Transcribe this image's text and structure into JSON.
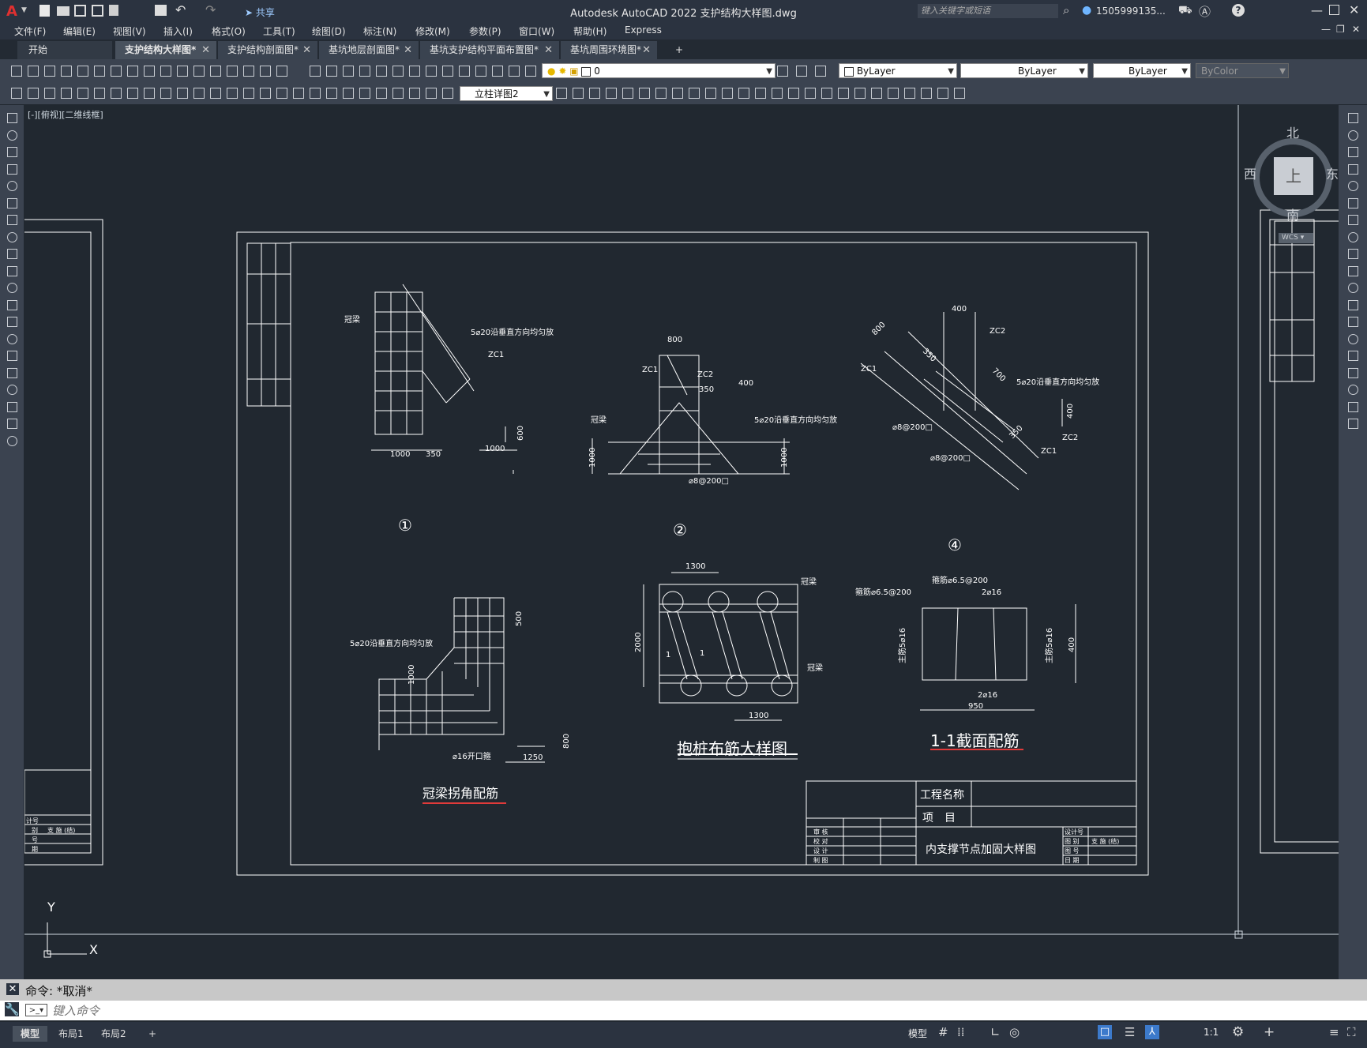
{
  "app": {
    "title": "Autodesk AutoCAD 2022    支护结构大样图.dwg",
    "share_label": "共享",
    "search_placeholder": "键入关键字或短语",
    "user_label": "1505999135..."
  },
  "menu": [
    "文件(F)",
    "编辑(E)",
    "视图(V)",
    "插入(I)",
    "格式(O)",
    "工具(T)",
    "绘图(D)",
    "标注(N)",
    "修改(M)",
    "参数(P)",
    "窗口(W)",
    "帮助(H)",
    "Express"
  ],
  "tabs": [
    {
      "label": "开始",
      "active": false
    },
    {
      "label": "支护结构大样图*",
      "active": true
    },
    {
      "label": "支护结构剖面图*",
      "active": false
    },
    {
      "label": "基坑地层剖面图*",
      "active": false
    },
    {
      "label": "基坑支护结构平面布置图*",
      "active": false
    },
    {
      "label": "基坑周围环境图*",
      "active": false
    }
  ],
  "toolbar": {
    "layer_value": "0",
    "color_value": "ByLayer",
    "linetype_value": "ByLayer",
    "lineweight_value": "ByLayer",
    "plotstyle_value": "ByColor",
    "dimstyle_value": "立柱详图2"
  },
  "viewport": {
    "label": "[-][俯视][二维线框]",
    "compass_n": "北",
    "compass_s": "南",
    "compass_e": "东",
    "compass_w": "西",
    "compass_center": "上",
    "wcs": "WCS",
    "ucs_x": "X",
    "ucs_y": "Y"
  },
  "drawing": {
    "d1_label": "①",
    "d2_label": "②",
    "d4_label": "④",
    "d1_guanliang": "冠梁",
    "d1_rebar": "5⌀20沿垂直方向均匀放",
    "d1_zc1": "ZC1",
    "d1_dim_a": "1000",
    "d1_dim_b": "350",
    "d1_dim_c": "1000",
    "d1_dim_d": "600",
    "d2_dim_top": "800",
    "d2_zc1": "ZC1",
    "d2_zc2": "ZC2",
    "d2_dim_350": "350",
    "d2_dim_400": "400",
    "d2_rebar": "5⌀20沿垂直方向均匀放",
    "d2_guanliang": "冠梁",
    "d2_stirrup": "⌀8@200□",
    "d2_dim_l": "1000",
    "d2_dim_r": "1000",
    "d4_dim_400": "400",
    "d4_dim_800": "800",
    "d4_zc2a": "ZC2",
    "d4_zc1": "ZC1",
    "d4_dim_350": "350",
    "d4_dim_700": "700",
    "d4_rebar": "5⌀20沿垂直方向均匀放",
    "d4_dim_400b": "400",
    "d4_stirrup_a": "⌀8@200□",
    "d4_zc2b": "ZC2",
    "d4_dim_350b": "350",
    "d4_zc1b": "ZC1",
    "d4_stirrup_b": "⌀8@200□",
    "c_rebar": "5⌀20沿垂直方向均匀放",
    "c_dim_500": "500",
    "c_dim_1000": "1000",
    "c_hoop": "⌀16开口箍",
    "c_dim_1250": "1250",
    "c_dim_800": "800",
    "c_title": "冠梁拐角配筋",
    "p_dim_1300a": "1300",
    "p_guanliang_a": "冠梁",
    "p_dim_2000": "2000",
    "p_cut": "1",
    "p_cut2": "1",
    "p_guanliang_b": "冠梁",
    "p_dim_1300b": "1300",
    "p_title": "抱桩布筋大样图",
    "s_stirrup_a": "箍筋⌀6.5@200",
    "s_stirrup_b": "箍筋⌀6.5@200",
    "s_top": "2⌀16",
    "s_left": "主筋5⌀16",
    "s_right": "主筋5⌀16",
    "s_bottom": "2⌀16",
    "s_dim_950": "950",
    "s_dim_400": "400",
    "s_title": "1-1截面配筋",
    "tb_project_name": "工程名称",
    "tb_item": "项　目",
    "tb_drawing_name": "内支撑节点加固大样图",
    "tb_shen": "审 核",
    "tb_jiao": "校 对",
    "tb_she": "设 计",
    "tb_zhi": "制 图",
    "tb_no": "设计号",
    "tb_cat": "图 别",
    "tb_cat_val": "支 施 (结)",
    "tb_num": "图 号",
    "tb_date": "日 期",
    "left_tb_a": "计号",
    "left_tb_b": "别",
    "left_tb_b_val": "支 施 (结)",
    "left_tb_c": "号",
    "left_tb_d": "期"
  },
  "command": {
    "history": "命令: *取消*",
    "placeholder": "键入命令"
  },
  "layout_tabs": [
    "模型",
    "布局1",
    "布局2"
  ],
  "status": {
    "model": "模型",
    "scale": "1:1"
  }
}
